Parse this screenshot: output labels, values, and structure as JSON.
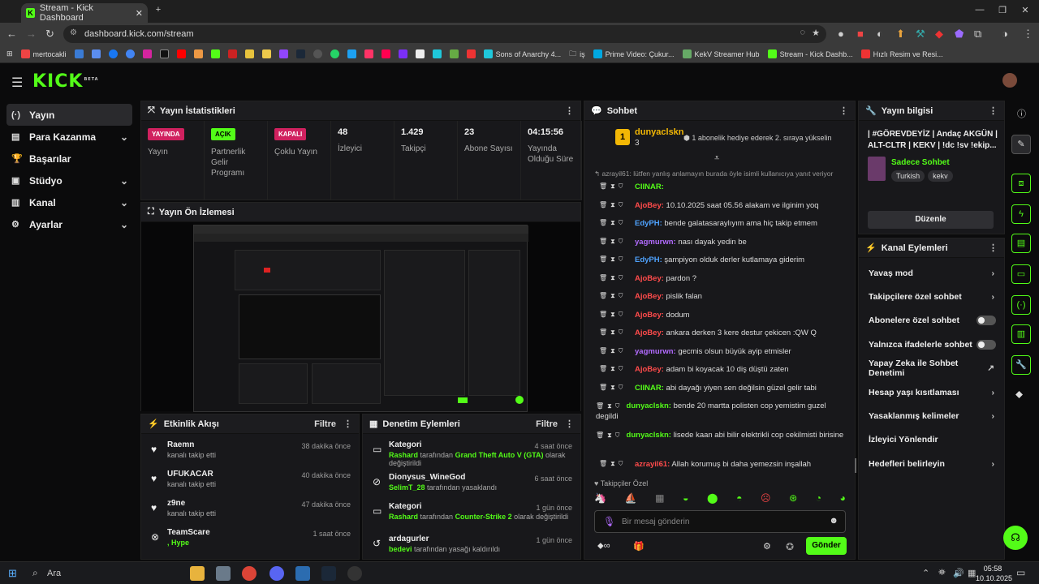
{
  "browser": {
    "tab_title": "Stream - Kick Dashboard",
    "url": "dashboard.kick.com/stream",
    "bookmarks": [
      "",
      "mertocakli",
      "",
      "",
      "",
      "",
      "",
      "",
      "",
      "",
      "",
      "",
      "",
      "",
      "",
      "",
      "",
      "",
      "",
      "",
      "",
      "",
      "",
      "",
      "",
      "",
      "",
      "",
      "",
      "",
      "",
      "",
      "",
      "Sons of Anarchy 4...",
      "iş",
      "Prime Video: Çukur...",
      "KekV Streamer Hub",
      "Stream - Kick Dashb...",
      "Hızlı Resim ve Resi..."
    ]
  },
  "brand": {
    "logo": "KICK",
    "beta": "BETA"
  },
  "sidebar": {
    "items": [
      {
        "icon": "(·)",
        "label": "Yayın",
        "chev": ""
      },
      {
        "icon": "▤",
        "label": "Para Kazanma",
        "chev": "⌄"
      },
      {
        "icon": "🏆",
        "label": "Başarılar",
        "chev": ""
      },
      {
        "icon": "▣",
        "label": "Stüdyo",
        "chev": "⌄"
      },
      {
        "icon": "▥",
        "label": "Kanal",
        "chev": "⌄"
      },
      {
        "icon": "⚙",
        "label": "Ayarlar",
        "chev": "⌄"
      }
    ]
  },
  "stats": {
    "title": "Yayın İstatistikleri",
    "cells": [
      {
        "badge": "YAYINDA",
        "label": "Yayın"
      },
      {
        "badge": "AÇIK",
        "label": "Partnerlik Gelir Programı"
      },
      {
        "badge": "KAPALI",
        "label": "Çoklu Yayın"
      },
      {
        "num": "48",
        "label": "İzleyici"
      },
      {
        "num": "1.429",
        "label": "Takipçi"
      },
      {
        "num": "23",
        "label": "Abone Sayısı"
      },
      {
        "num": "04:15:56",
        "label": "Yayında Olduğu Süre"
      }
    ]
  },
  "preview": {
    "title": "Yayın Ön İzlemesi"
  },
  "activity": {
    "title": "Etkinlik Akışı",
    "filter": "Filtre",
    "items": [
      {
        "icon": "♥",
        "name": "Raemn",
        "sub": "kanalı takip etti",
        "time": "38 dakika önce"
      },
      {
        "icon": "♥",
        "name": "UFUKACAR",
        "sub": "kanalı takip etti",
        "time": "40 dakika önce"
      },
      {
        "icon": "♥",
        "name": "z9ne",
        "sub": "kanalı takip etti",
        "time": "47 dakika önce"
      },
      {
        "icon": "⊗",
        "name": "TeamScare",
        "sub": ", Hype",
        "time": "1 saat önce"
      }
    ]
  },
  "moderation": {
    "title": "Denetim Eylemleri",
    "filter": "Filtre",
    "items": [
      {
        "icon": "▭",
        "name": "Kategori",
        "who": "Rashard",
        "mid": " tarafından ",
        "target": "Grand Theft Auto V (GTA)",
        "end": " olarak değiştirildi",
        "time": "4 saat önce"
      },
      {
        "icon": "⊘",
        "name": "Dionysus_WineGod",
        "who": "SelimT_28",
        "mid": " tarafından yasaklandı",
        "target": "",
        "end": "",
        "time": "6 saat önce"
      },
      {
        "icon": "▭",
        "name": "Kategori",
        "who": "Rashard",
        "mid": " tarafından ",
        "target": "Counter-Strike 2",
        "end": " olarak değiştirildi",
        "time": "1 gün önce"
      },
      {
        "icon": "↺",
        "name": "ardagurler",
        "who": "bedevi",
        "mid": " tarafından yasağı kaldırıldı",
        "target": "",
        "end": "",
        "time": "1 gün önce"
      }
    ]
  },
  "chat": {
    "title": "Sohbet",
    "pinned_user": "dunyaclskn",
    "pinned_count": "3",
    "pinned_msg": "1 abonelik hediye ederek 2. sıraya yükselin",
    "reply_line": "azrayil61: lütfen yanlış anlamayın burada öyle isimli kullanıcıya yanıt veriyor",
    "messages": [
      {
        "user": "CIINAR:",
        "color": "#53fc18",
        "text": ""
      },
      {
        "user": "AjoBey:",
        "color": "#ff4b4b",
        "text": " 10.10.2025 saat 05.56 alakam ve ilginim yoq"
      },
      {
        "user": "EdyPH:",
        "color": "#4fa3ff",
        "text": " bende galatasaraylıyım ama hiç takip etmem"
      },
      {
        "user": "yagmurwn:",
        "color": "#b26bff",
        "text": " nası dayak yedin be"
      },
      {
        "user": "EdyPH:",
        "color": "#4fa3ff",
        "text": " şampiyon olduk derler kutlamaya giderim"
      },
      {
        "user": "AjoBey:",
        "color": "#ff4b4b",
        "text": " pardon ?"
      },
      {
        "user": "AjoBey:",
        "color": "#ff4b4b",
        "text": " pislik falan"
      },
      {
        "user": "AjoBey:",
        "color": "#ff4b4b",
        "text": " dodum"
      },
      {
        "user": "AjoBey:",
        "color": "#ff4b4b",
        "text": " ankara derken 3 kere destur çekicen :QW Q"
      },
      {
        "user": "yagmurwn:",
        "color": "#b26bff",
        "text": " gecmis olsun büyük ayip etmisler"
      },
      {
        "user": "AjoBey:",
        "color": "#ff4b4b",
        "text": " adam bi koyacak 10 diş düştü zaten"
      },
      {
        "user": "CIINAR:",
        "color": "#53fc18",
        "text": " abi dayağı yiyen sen değilsin güzel gelir tabi"
      },
      {
        "user": "dunyaclskn:",
        "color": "#53fc18",
        "text": " bende 20 martta polisten cop yemistim guzel degildi"
      },
      {
        "user": "dunyaclskn:",
        "color": "#53fc18",
        "text": " lisede kaan abi bilir elektrikli cop cekilmisti birisine"
      },
      {
        "user": "azrayil61:",
        "color": "#ff4b4b",
        "text": " Allah korumuş bi daha yemezsin inşallah"
      }
    ],
    "followers_only": "Takipçiler Özel",
    "placeholder": "Bir mesaj gönderin",
    "send": "Gönder"
  },
  "info": {
    "title": "Yayın bilgisi",
    "stream_title": "| #GÖREVDEYİZ | Andaç AKGÜN | ALT-CLTR | KEKV | !dc !sv !ekip...",
    "category": "Sadece Sohbet",
    "tags": [
      "Turkish",
      "kekv"
    ],
    "edit": "Düzenle"
  },
  "actions": {
    "title": "Kanal Eylemleri",
    "items": [
      {
        "label": "Yavaş mod",
        "ctrl": "chev"
      },
      {
        "label": "Takipçilere özel sohbet",
        "ctrl": "chev"
      },
      {
        "label": "Abonelere özel sohbet",
        "ctrl": "toggle"
      },
      {
        "label": "Yalnızca ifadelerle sohbet",
        "ctrl": "toggle"
      },
      {
        "label": "Yapay Zeka ile Sohbet Denetimi",
        "ctrl": "ext"
      },
      {
        "label": "Hesap yaşı kısıtlaması",
        "ctrl": "chev"
      },
      {
        "label": "Yasaklanmış kelimeler",
        "ctrl": "chev"
      },
      {
        "label": "İzleyici Yönlendir",
        "ctrl": ""
      },
      {
        "label": "Hedefleri belirleyin",
        "ctrl": "chev"
      }
    ]
  },
  "taskbar": {
    "search": "Ara",
    "time": "05:58",
    "date": "10.10.2025"
  }
}
